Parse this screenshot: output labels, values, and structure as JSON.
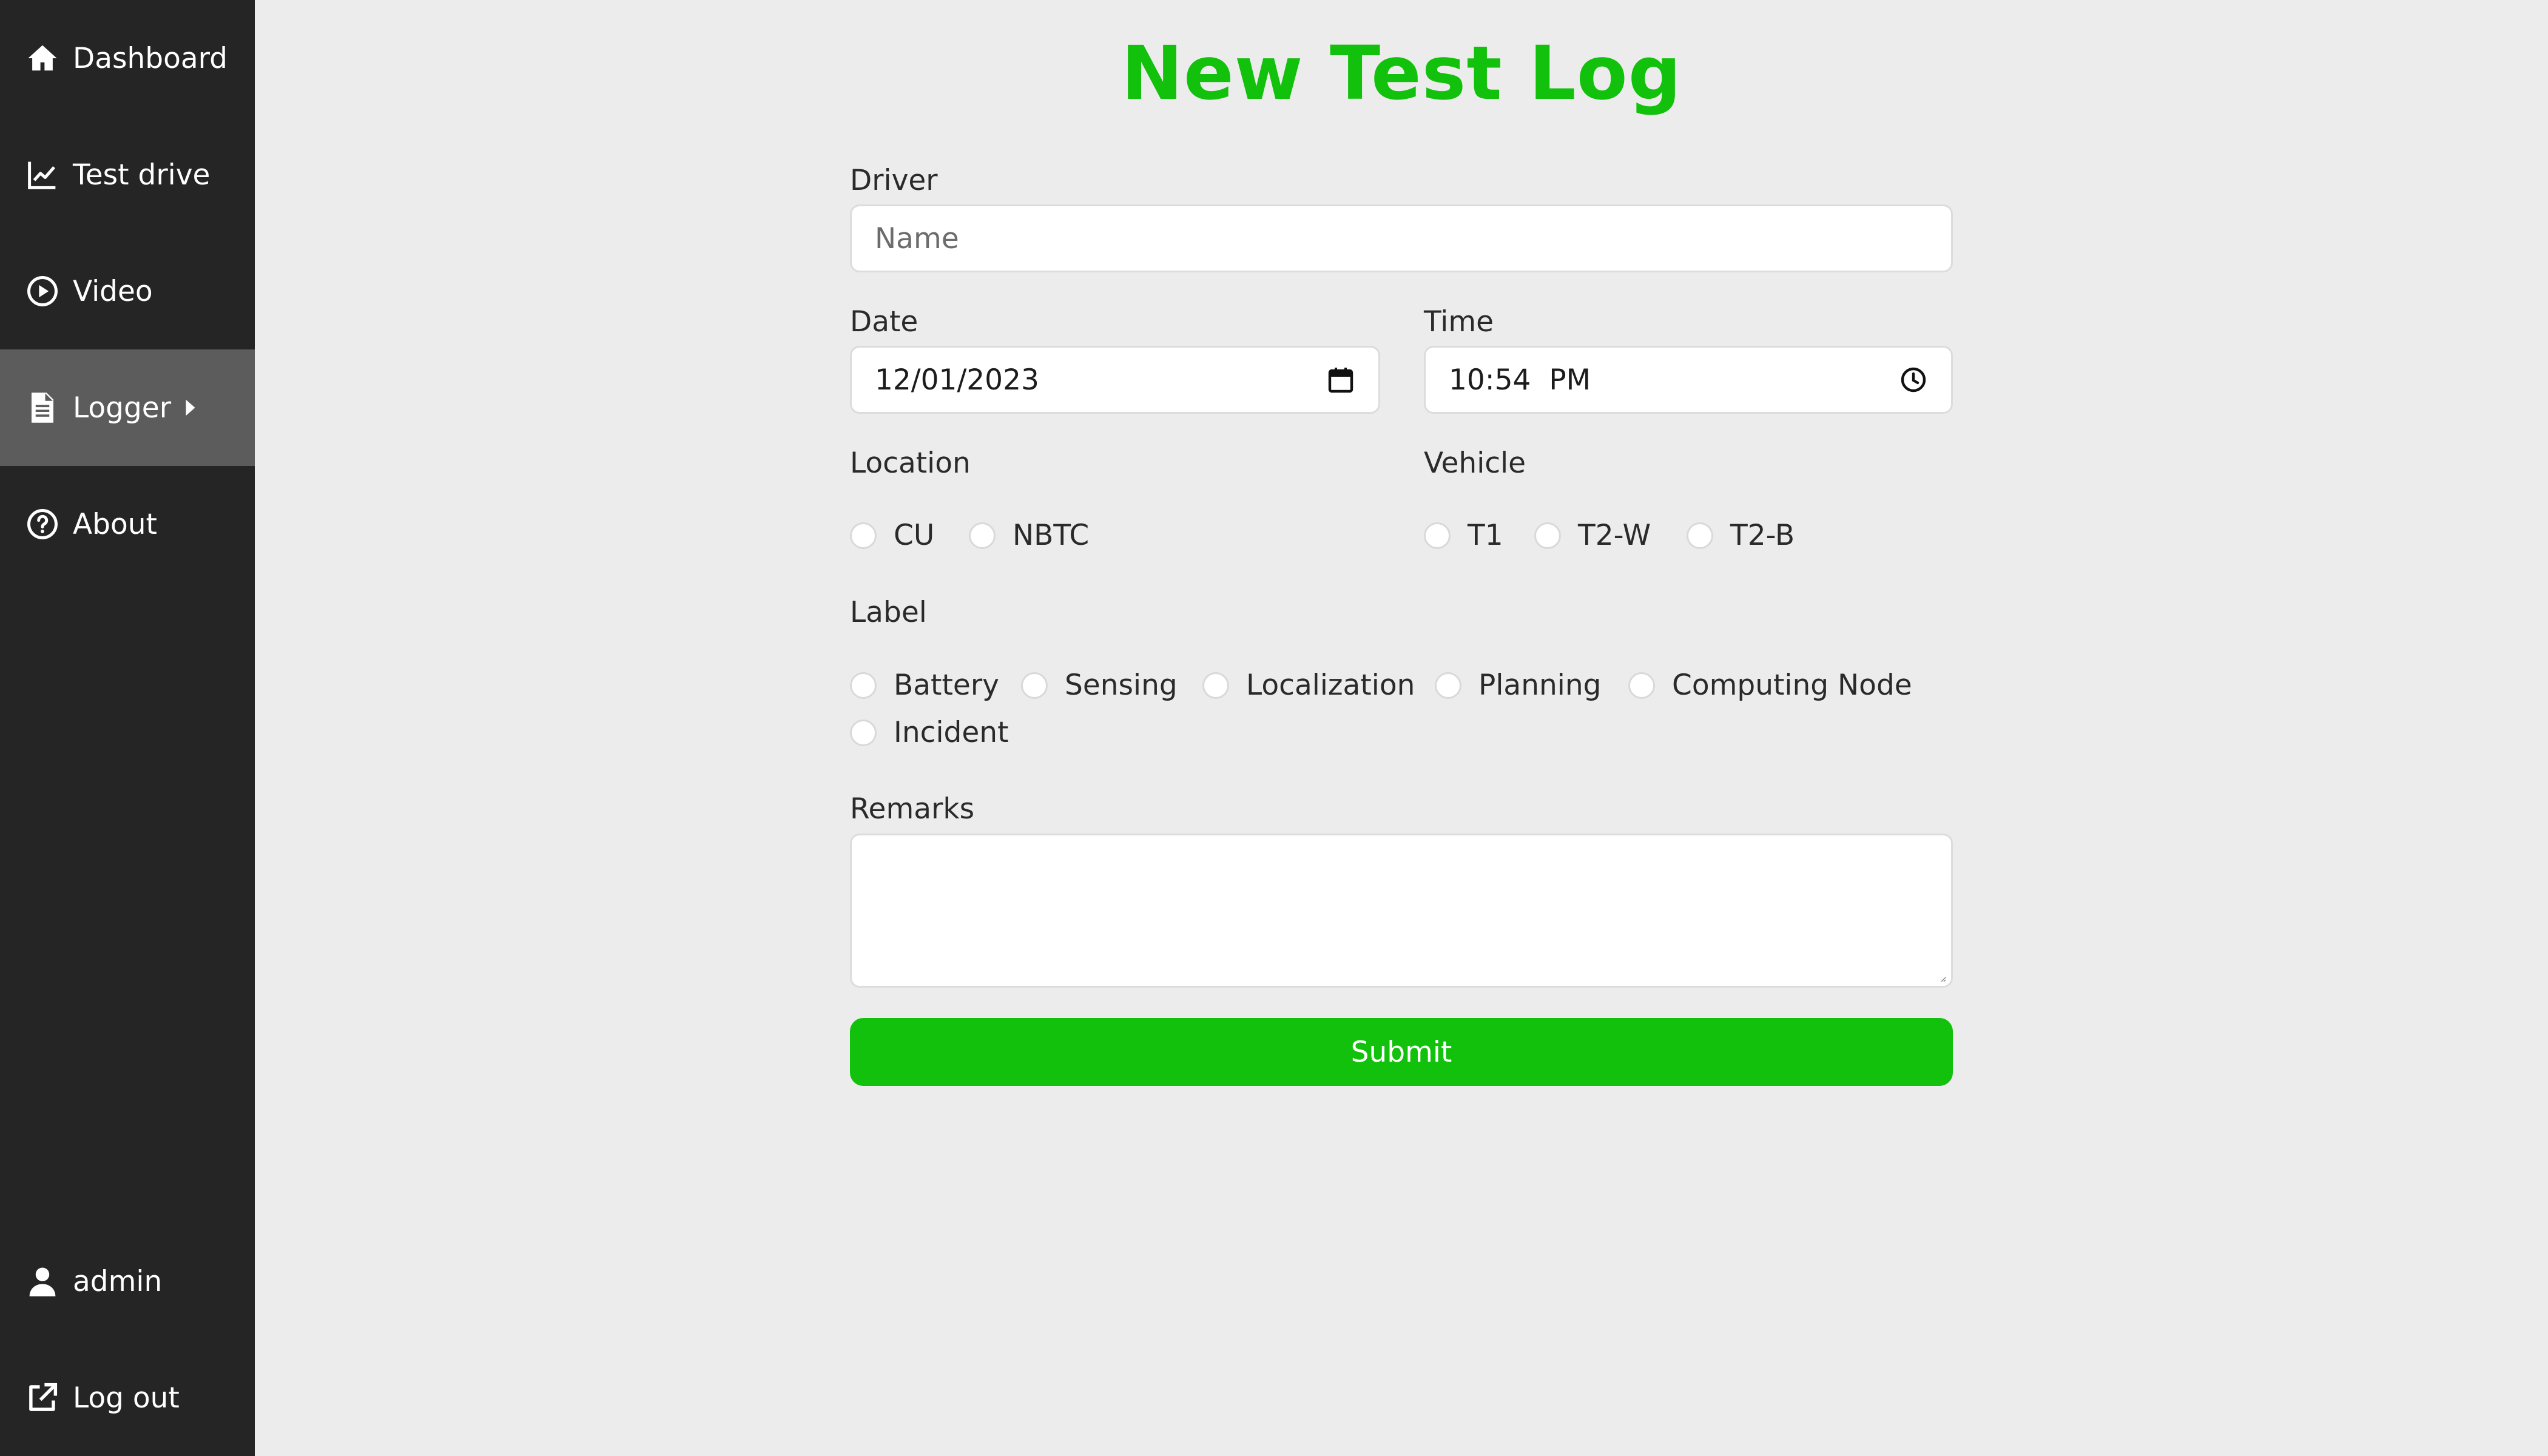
{
  "sidebar": {
    "items": [
      {
        "label": "Dashboard",
        "icon": "home-icon"
      },
      {
        "label": "Test drive",
        "icon": "chart-line-icon"
      },
      {
        "label": "Video",
        "icon": "play-circle-icon"
      },
      {
        "label": "Logger",
        "icon": "file-text-icon",
        "active": true
      },
      {
        "label": "About",
        "icon": "question-circle-icon"
      }
    ],
    "user": {
      "label": "admin",
      "icon": "user-icon"
    },
    "logout": {
      "label": "Log out",
      "icon": "external-link-icon"
    }
  },
  "form": {
    "title": "New Test Log",
    "driver": {
      "label": "Driver",
      "placeholder": "Name",
      "value": ""
    },
    "date": {
      "label": "Date",
      "value": "12/01/2023"
    },
    "time": {
      "label": "Time",
      "value": "10:54  PM"
    },
    "location": {
      "label": "Location",
      "options": [
        "CU",
        "NBTC"
      ]
    },
    "vehicle": {
      "label": "Vehicle",
      "options": [
        "T1",
        "T2-W",
        "T2-B"
      ]
    },
    "label_group": {
      "label": "Label",
      "options": [
        "Battery",
        "Sensing",
        "Localization",
        "Planning",
        "Computing Node",
        "Incident"
      ]
    },
    "remarks": {
      "label": "Remarks",
      "value": ""
    },
    "submit_label": "Submit"
  },
  "colors": {
    "accent": "#12c10b",
    "sidebar_bg": "#252525",
    "sidebar_active": "#5c5c5c",
    "page_bg": "#ececec"
  }
}
